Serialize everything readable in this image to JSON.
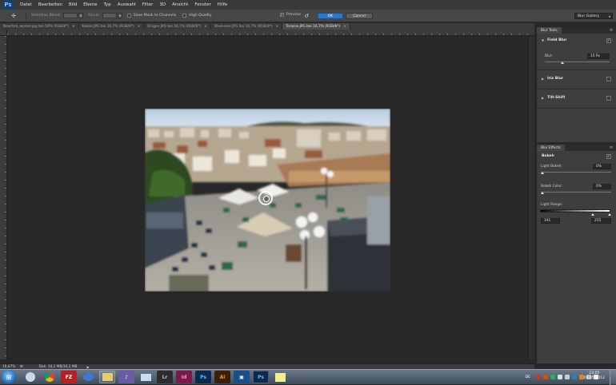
{
  "menubar": {
    "logo": "Ps",
    "items": [
      "Datei",
      "Bearbeiten",
      "Bild",
      "Ebene",
      "Typ",
      "Auswahl",
      "Filter",
      "3D",
      "Ansicht",
      "Fenster",
      "Hilfe"
    ]
  },
  "options": {
    "selection_bleed": "Selection Bleed:",
    "focus": "Focus:",
    "save_mask": "Save Mask to Channels",
    "high_quality": "High Quality",
    "preview": "Preview",
    "ok": "OK",
    "cancel": "Cancel",
    "workspace": "Blur Gallery"
  },
  "tabs": [
    {
      "label": "NewYork_worker.jpg bei 50% (RGB/8*)",
      "active": false
    },
    {
      "label": "Katzer.JPG bei 16,7% (RGB/8*)",
      "active": false
    },
    {
      "label": "Ringen.JPG bei 16,7% (RGB/8*)",
      "active": false
    },
    {
      "label": "Stockrose.JPG bei 16,7% (RGB/8*)",
      "active": false
    },
    {
      "label": "Terasse.JPG bei 16,7% (RGB/8*)",
      "active": true
    }
  ],
  "blur_tools": {
    "title": "Blur Tools",
    "field_blur": "Field Blur",
    "blur_label": "Blur:",
    "blur_value": "15 Px",
    "blur_level": 0.3,
    "iris_blur": "Iris Blur",
    "tilt_shift": "Tilt-Shift"
  },
  "blur_effects": {
    "title": "Blur Effects",
    "bokeh": "Bokeh",
    "light_bokeh_label": "Light Bokeh:",
    "light_bokeh_value": "0%",
    "bokeh_color_label": "Bokeh Color:",
    "bokeh_color_value": "0%",
    "light_range_label": "Light Range:",
    "light_range_low": "191",
    "light_range_high": "255"
  },
  "status": {
    "zoom": "16,67%",
    "doc": "Dok: 34,2 MB/34,2 MB"
  },
  "taskbar": {
    "apps": [
      "explorer",
      "chrome",
      "filezilla",
      "thunderbird",
      "folder",
      "winamp",
      "mail",
      "Lr",
      "Id",
      "Ps",
      "Ai",
      "xd",
      "Ps",
      "folder2"
    ],
    "lang": "DE",
    "time": "23:05",
    "date": "03.05.2012"
  },
  "colors": {
    "accent": "#2f78c8",
    "panel": "#3e3e3e",
    "canvas": "#282828"
  }
}
